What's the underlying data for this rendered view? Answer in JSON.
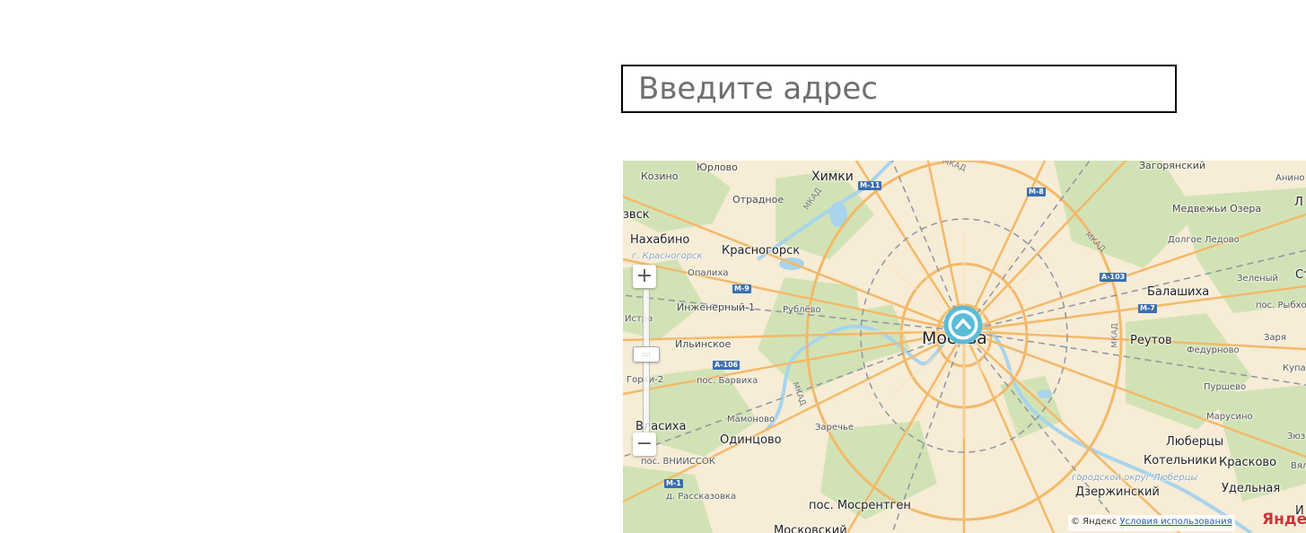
{
  "search": {
    "placeholder": "Введите адрес",
    "value": ""
  },
  "map": {
    "center_label": "Москва",
    "labels": [
      "Юрлово",
      "Химки",
      "Загорянский",
      "Анино",
      "Козино",
      "Отрадное",
      "Медвежьи Озера",
      "Долгое Ледово",
      "Нахабино",
      "Красногорск",
      "Опалиха",
      "Зеленый",
      "Балашиха",
      "пос. Рыбхоз",
      "Инженерный-1",
      "Рублёво",
      "Истра",
      "Реутов",
      "Федурново",
      "Заря",
      "Ильинское",
      "Купавна",
      "Горки-2",
      "пос. Барвиха",
      "Пуршево",
      "Мамоново",
      "Марусино",
      "Власиха",
      "Одинцово",
      "Заречье",
      "Люберцы",
      "Котельники",
      "Красково",
      "пос. ВНИИССОК",
      "Дзержинский",
      "Удельная",
      "д. Рассказовка",
      "пос. Мосрентген",
      "Московский",
      "звск",
      "Ст",
      "Л",
      "Зюз",
      "Вял",
      "И"
    ],
    "district_labels": [
      "г. Красногорск",
      "городской округ Люберцы"
    ],
    "road_shields": [
      "М-11",
      "М-8",
      "А-103",
      "М-7",
      "М-9",
      "А-106",
      "М-1"
    ],
    "ring_road_label": "МКАД",
    "copyright_text": "© Яндекс",
    "terms_link": "Условия использования",
    "logo_text": "Яндекс",
    "zoom_in": "+",
    "zoom_out": "−",
    "zoom_level": 0.55
  },
  "colors": {
    "map_base": "#f7ecd5",
    "forest": "#cfe3b4",
    "water": "#a8d4ec",
    "major_road": "#f3b96a",
    "railway": "#8d95a3",
    "pin": "#5bbcd6"
  }
}
